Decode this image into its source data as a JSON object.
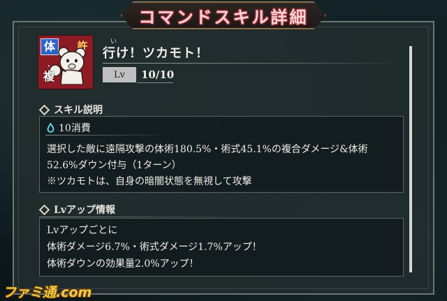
{
  "header": {
    "title": "コマンドスキル詳細"
  },
  "skill": {
    "badges": {
      "type": "体",
      "target": "複",
      "extra": "許"
    },
    "ruby": "い",
    "name": "行け！ツカモト！",
    "level_label": "Lv",
    "level_value": "10/10"
  },
  "description_section": {
    "heading": "スキル説明",
    "cost": "10消費",
    "lines": [
      "選択した敵に遠隔攻撃の体術180.5%・術式45.1%の複合ダメージ&体術",
      "52.6%ダウン付与（1ターン）",
      "※ツカモトは、自身の暗闇状態を無視して攻撃"
    ]
  },
  "levelup_section": {
    "heading": "Lvアップ情報",
    "lines": [
      "Lvアップごとに",
      "体術ダメージ6.7%・術式ダメージ1.7%アップ！",
      "体術ダウンの効果量2.0%アップ！"
    ]
  },
  "watermark": "ファミ通.com",
  "colors": {
    "accent_red": "#8d1b24",
    "badge_blue": "#2c63c8",
    "title_glow": "#c0404c"
  },
  "icons": [
    "bear-punch-icon",
    "drop-icon",
    "diamond-icon"
  ]
}
